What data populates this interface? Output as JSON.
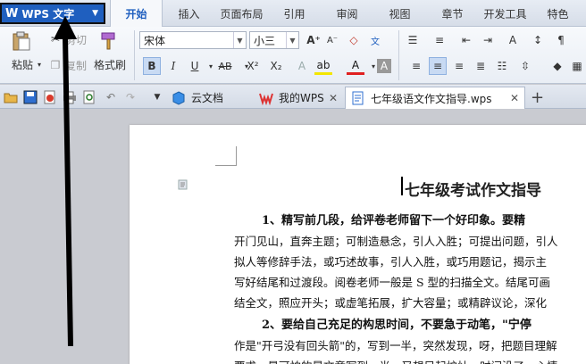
{
  "app": {
    "name": "WPS 文字",
    "logo": "W"
  },
  "menu": {
    "tabs": [
      "开始",
      "插入",
      "页面布局",
      "引用",
      "审阅",
      "视图",
      "章节",
      "开发工具",
      "特色"
    ],
    "active": "开始"
  },
  "ribbon": {
    "paste_label": "粘贴",
    "cut_label": "剪切",
    "copy_label": "复制",
    "format_painter_label": "格式刷",
    "font_name": "宋体",
    "font_size": "小三",
    "bold": "B",
    "italic": "I",
    "underline": "U",
    "strike": "AB",
    "superscript": "X²",
    "subscript": "X₂",
    "font_color_letter": "A"
  },
  "tabbar": {
    "doc_tabs": [
      {
        "label": "云文档"
      },
      {
        "label": "我的WPS"
      },
      {
        "label": "七年级语文作文指导.wps"
      }
    ]
  },
  "document": {
    "title": "七年级考试作文指导",
    "lines": [
      "1、精写前几段，给评卷老师留下一个好印象。要精",
      "开门见山，直奔主题；可制造悬念，引人入胜；可提出问题，引人",
      "拟人等修辞手法，或巧述故事，引人入胜，或巧用题记，揭示主",
      "写好结尾和过渡段。阅卷老师一般是 S 型的扫描全文。结尾可画",
      "结全文，照应开头；或虚笔拓展，扩大容量；或精辟议论，深化",
      "2、要给自己充足的构思时间，不要急于动笔，\"宁停",
      "作是\"开弓没有回头箭\"的，写到一半，突然发现，呀，把题目理解",
      "要求。最可怕的是文章写到一半，又想另起炉灶。时间没了，心情"
    ]
  },
  "colors": {
    "app_blue": "#1f5fbf",
    "ribbon_bg": "#eef2f8",
    "doc_bg": "#c9cbd1"
  }
}
